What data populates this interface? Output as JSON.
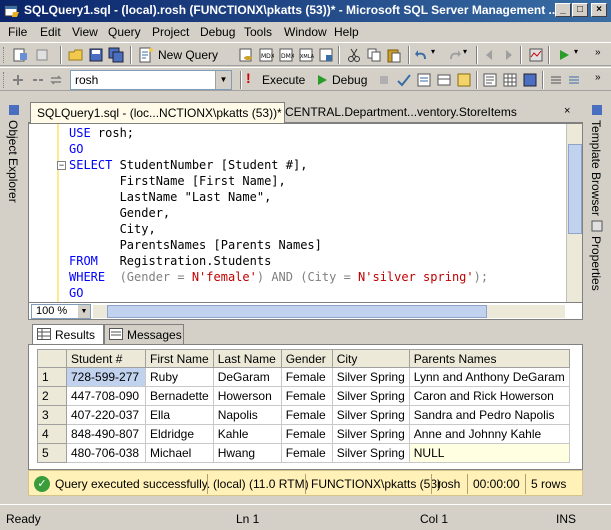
{
  "window": {
    "title": "SQLQuery1.sql - (local).rosh (FUNCTIONX\\pkatts (53))* - Microsoft SQL Server Management ...",
    "minimize_label": "_",
    "maximize_label": "□",
    "close_label": "×"
  },
  "menu": {
    "items": [
      "File",
      "Edit",
      "View",
      "Query",
      "Project",
      "Debug",
      "Tools",
      "Window",
      "Help"
    ]
  },
  "toolbar1": {
    "new_query_label": "New Query"
  },
  "toolbar2": {
    "database": "rosh",
    "execute_label": "Execute",
    "debug_label": "Debug"
  },
  "side_left": {
    "object_explorer_label": "Object Explorer"
  },
  "side_right": {
    "template_browser_label": "Template Browser",
    "properties_label": "Properties"
  },
  "doc_tabs": {
    "active": "SQLQuery1.sql - (loc...NCTIONX\\pkatts (53))*",
    "inactive": "CENTRAL.Department...ventory.StoreItems",
    "pin_label": "×"
  },
  "editor": {
    "lines": {
      "l1_kw": "USE",
      "l1_rest": " rosh;",
      "l2_kw": "GO",
      "l3_kw": "SELECT",
      "l3_rest": " StudentNumber [Student #],",
      "l4": "       FirstName [First Name],",
      "l5": "       LastName \"Last Name\",",
      "l6": "       Gender,",
      "l7": "       City,",
      "l8": "       ParentsNames [Parents Names]",
      "l9_kw": "FROM",
      "l9_rest": "   Registration.Students",
      "l10_kw": "WHERE",
      "l10_p1": "  (Gender = ",
      "l10_s1": "N'female'",
      "l10_p2": ") ",
      "l10_and": "AND",
      "l10_p3": " (City = ",
      "l10_s2": "N'silver spring'",
      "l10_p4": ");",
      "l11_kw": "GO"
    },
    "collapse_label": "−",
    "zoom": "100 %"
  },
  "results_tabs": {
    "results_label": "Results",
    "messages_label": "Messages"
  },
  "grid": {
    "columns": [
      "Student #",
      "First Name",
      "Last Name",
      "Gender",
      "City",
      "Parents Names"
    ],
    "rows": [
      [
        "1",
        "728-599-277",
        "Ruby",
        "DeGaram",
        "Female",
        "Silver Spring",
        "Lynn and Anthony DeGaram"
      ],
      [
        "2",
        "447-708-090",
        "Bernadette",
        "Howerson",
        "Female",
        "Silver Spring",
        "Caron and Rick Howerson"
      ],
      [
        "3",
        "407-220-037",
        "Ella",
        "Napolis",
        "Female",
        "Silver Spring",
        "Sandra and Pedro Napolis"
      ],
      [
        "4",
        "848-490-807",
        "Eldridge",
        "Kahle",
        "Female",
        "Silver Spring",
        "Anne and Johnny Kahle"
      ],
      [
        "5",
        "480-706-038",
        "Michael",
        "Hwang",
        "Female",
        "Silver Spring",
        "NULL"
      ]
    ]
  },
  "query_status": {
    "message": "Query executed successfully.",
    "server": "(local) (11.0 RTM)",
    "user": "FUNCTIONX\\pkatts (53)",
    "database": "rosh",
    "elapsed": "00:00:00",
    "rows": "5 rows",
    "check_glyph": "✓"
  },
  "statusbar": {
    "ready": "Ready",
    "ln": "Ln 1",
    "col": "Col 1",
    "ins": "INS"
  },
  "colors": {
    "title_gradient_start": "#0a246a",
    "title_gradient_end": "#3a6ea5",
    "keyword": "#0000ff",
    "string": "#c00000",
    "status_bar_bg": "#fff1b8"
  }
}
